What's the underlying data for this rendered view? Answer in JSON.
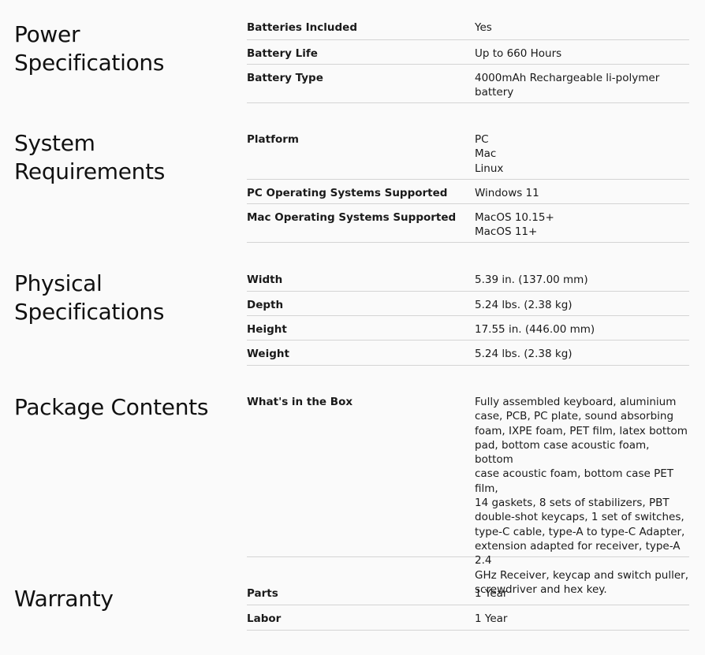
{
  "sections": [
    {
      "title": "Power Specifications",
      "rows": [
        {
          "label": "Batteries Included",
          "value": [
            "Yes"
          ]
        },
        {
          "label": "Battery Life",
          "value": [
            "Up to 660 Hours"
          ]
        },
        {
          "label": "Battery Type",
          "value": [
            "4000mAh Rechargeable li-polymer",
            "battery"
          ]
        }
      ]
    },
    {
      "title": "System Requirements",
      "rows": [
        {
          "label": "Platform",
          "value": [
            "PC",
            "Mac",
            "Linux"
          ]
        },
        {
          "label": "PC Operating Systems Supported",
          "value": [
            "Windows 11"
          ]
        },
        {
          "label": "Mac Operating Systems Supported",
          "value": [
            "MacOS 10.15+",
            "MacOS 11+"
          ]
        }
      ]
    },
    {
      "title": "Physical Specifications",
      "rows": [
        {
          "label": "Width",
          "value": [
            "5.39 in. (137.00 mm)"
          ]
        },
        {
          "label": "Depth",
          "value": [
            "5.24 lbs. (2.38 kg)"
          ]
        },
        {
          "label": "Height",
          "value": [
            "17.55 in. (446.00 mm)"
          ]
        },
        {
          "label": "Weight",
          "value": [
            "5.24 lbs. (2.38 kg)"
          ]
        }
      ]
    },
    {
      "title": "Package Contents",
      "rows": [
        {
          "label": "What's in the Box",
          "value": [
            "Fully assembled keyboard, aluminium",
            "case, PCB, PC plate, sound absorbing",
            "foam, IXPE foam, PET film, latex bottom",
            "pad, bottom case acoustic foam, bottom",
            "case acoustic foam, bottom case PET film,",
            "14 gaskets, 8 sets of stabilizers, PBT",
            "double-shot keycaps, 1 set of switches,",
            "type-C cable, type-A to type-C Adapter,",
            "extension adapted for receiver, type-A 2.4",
            "GHz Receiver, keycap and switch puller,",
            "screwdriver and hex key."
          ]
        }
      ]
    },
    {
      "title": "Warranty",
      "rows": [
        {
          "label": "Parts",
          "value": [
            "1 Year"
          ]
        },
        {
          "label": "Labor",
          "value": [
            "1 Year"
          ]
        }
      ]
    }
  ]
}
